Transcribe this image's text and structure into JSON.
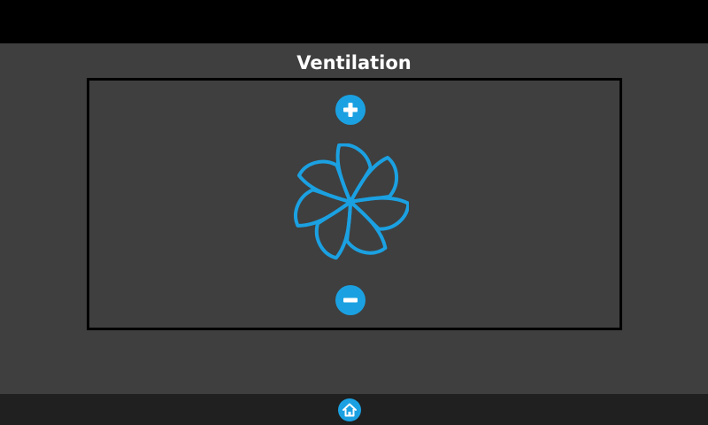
{
  "header": {
    "title": "Ventilation"
  },
  "controls": {
    "increase_icon": "plus-circle-icon",
    "decrease_icon": "minus-circle-icon"
  },
  "fan": {
    "icon": "fan-icon",
    "blade_count": 7
  },
  "footer": {
    "home_icon": "home-icon"
  },
  "colors": {
    "accent": "#1ba1e2",
    "background": "#3f3f3f",
    "topbar": "#000000",
    "bottombar": "#202020",
    "panel_border": "#000000",
    "title_text": "#ffffff"
  }
}
